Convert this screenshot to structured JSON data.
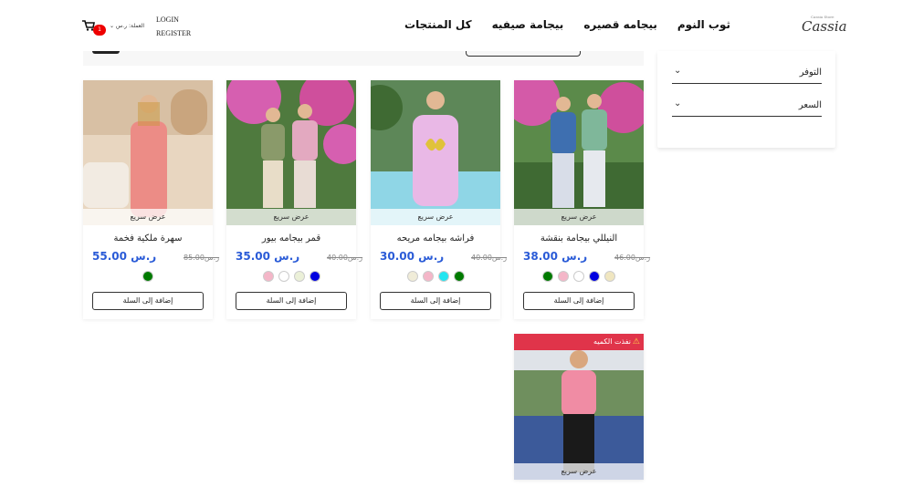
{
  "header": {
    "logo_text": "Cassia",
    "logo_small": "Cassia Store",
    "nav": [
      "كل المنتجات",
      "بيجامة صيفيه",
      "بيجامه قصيره",
      "ثوب النوم"
    ],
    "login": "LOGIN",
    "register": "REGISTER",
    "currency": "العملة: ر.س",
    "cart_count": "1"
  },
  "filters": {
    "items": [
      {
        "label": "التوفر"
      },
      {
        "label": "السعر"
      }
    ]
  },
  "products": [
    {
      "title": "النيللي بيجامة بنقشة",
      "price": "38.00 ر.س",
      "old_price": "46.00ر.س",
      "quick_view": "عرض سريع",
      "add_to_cart": "إضافة إلى السلة",
      "swatches": [
        "#f0e6c0",
        "#0000e0",
        "#ffffff",
        "#f4b6c8",
        "#007a00"
      ]
    },
    {
      "title": "فراشه بيجامه مريحه",
      "price": "30.00 ر.س",
      "old_price": "40.00ر.س",
      "quick_view": "عرض سريع",
      "add_to_cart": "إضافة إلى السلة",
      "swatches": [
        "#007a00",
        "#22e5f0",
        "#f4b6c8",
        "#f0ecd8"
      ]
    },
    {
      "title": "قمر بيجامه بيور",
      "price": "35.00 ر.س",
      "old_price": "40.00ر.س",
      "quick_view": "عرض سريع",
      "add_to_cart": "إضافة إلى السلة",
      "swatches": [
        "#0000e0",
        "#ebf0d8",
        "#ffffff",
        "#f4b6c8"
      ]
    },
    {
      "title": "سهرة ملكية فخمة",
      "price": "55.00 ر.س",
      "old_price": "85.00ر.س",
      "quick_view": "عرض سريع",
      "add_to_cart": "إضافة إلى السلة",
      "swatches": [
        "#007a00"
      ]
    },
    {
      "badge": "نفذت الكميه",
      "quick_view": "عرض سريع"
    }
  ],
  "colors": {
    "accent_price": "#2a5bd7",
    "soldout": "#e0344a",
    "badge": "#e00000"
  }
}
